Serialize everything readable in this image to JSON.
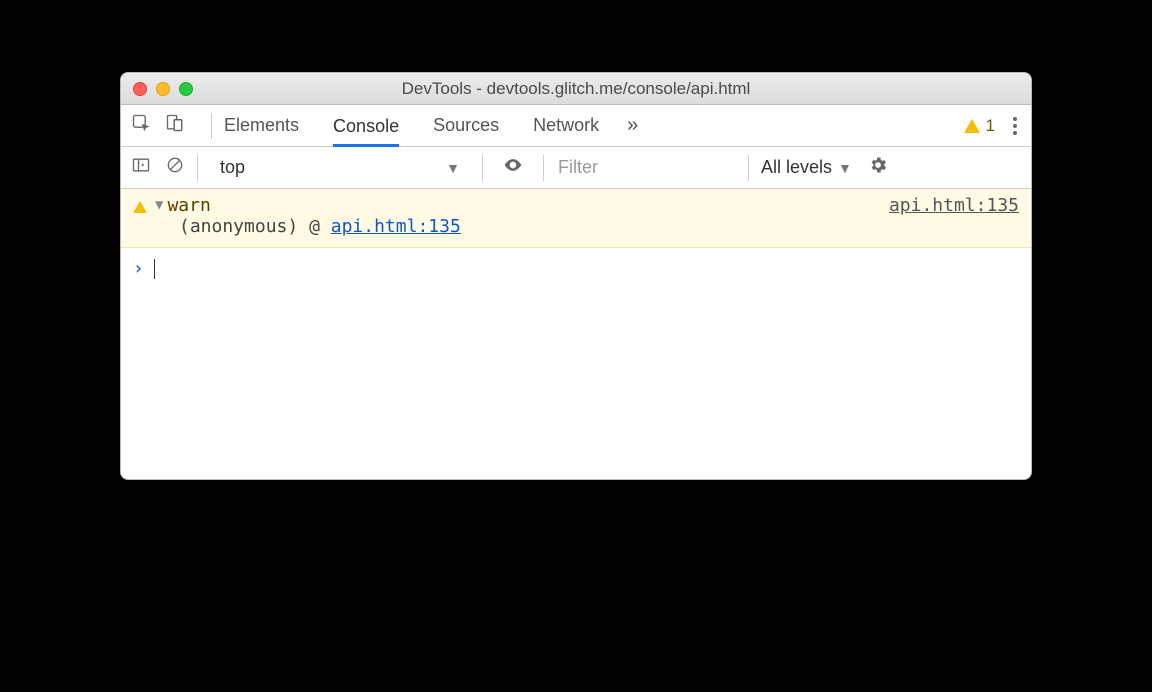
{
  "window": {
    "title": "DevTools - devtools.glitch.me/console/api.html"
  },
  "tabs": {
    "items": [
      "Elements",
      "Console",
      "Sources",
      "Network"
    ],
    "active": "Console",
    "warning_count": "1"
  },
  "toolbar": {
    "context": "top",
    "filter_placeholder": "Filter",
    "levels_label": "All levels"
  },
  "log": {
    "message": "warn",
    "source_link": "api.html:135",
    "trace_label": "(anonymous)",
    "trace_sep": "@",
    "trace_link": "api.html:135"
  }
}
